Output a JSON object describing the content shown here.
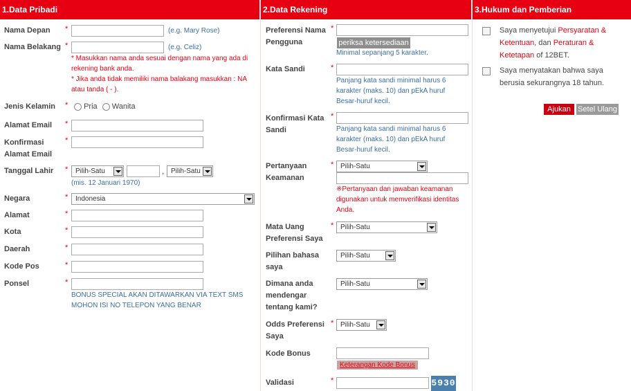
{
  "sections": {
    "personal": "1.Data Pribadi",
    "account": "2.Data Rekening",
    "terms": "3.Hukum dan Pemberian"
  },
  "personal": {
    "first_name": {
      "label": "Nama Depan",
      "value": "",
      "example": "(e.g. Mary Rose)"
    },
    "last_name": {
      "label": "Nama Belakang",
      "value": "",
      "example": "(e.g. Celiz)"
    },
    "last_name_note1": "* Masukkan nama anda sesuai dengan nama yang ada di rekening bank anda.",
    "last_name_note2": "* Jika anda tidak memiliki nama balakang masukkan : NA atau tanda ( - ).",
    "gender": {
      "label": "Jenis Kelamin",
      "male": "Pria",
      "female": "Wanita"
    },
    "email": {
      "label": "Alamat Email",
      "value": ""
    },
    "email_confirm": {
      "label": "Konfirmasi Alamat Email",
      "value": ""
    },
    "birthdate": {
      "label": "Tanggal Lahir",
      "day": "Pilih-Satu",
      "year": "",
      "month": "Pilih-Satu",
      "hint": "(mis. 12 Januari 1970)"
    },
    "country": {
      "label": "Negara",
      "value": "Indonesia"
    },
    "address": {
      "label": "Alamat",
      "value": ""
    },
    "city": {
      "label": "Kota",
      "value": ""
    },
    "region": {
      "label": "Daerah",
      "value": ""
    },
    "postcode": {
      "label": "Kode Pos",
      "value": ""
    },
    "phone": {
      "label": "Ponsel",
      "value": "",
      "hint": "BONUS SPECIAL AKAN DITAWARKAN VIA TEXT SMS MOHON ISI NO TELEPON YANG BENAR"
    }
  },
  "account": {
    "username": {
      "label": "Preferensi Nama Pengguna",
      "value": "",
      "check_button": "periksa ketersediaan",
      "hint": "Minimal sepanjang 5 karakter."
    },
    "password": {
      "label": "Kata Sandi",
      "value": "",
      "hint": "Panjang kata sandi minimal harus 6 karakter (maks. 10) dan pEkA huruf Besar-huruf kecil."
    },
    "password_confirm": {
      "label": "Konfirmasi Kata Sandi",
      "value": "",
      "hint": "Panjang kata sandi minimal harus 6 karakter (maks. 10) dan pEkA huruf Besar-huruf kecil."
    },
    "security_question": {
      "label": "Pertanyaan Keamanan",
      "value": "Pilih-Satu",
      "answer": "",
      "note": "※Pertanyaan dan jawaban keamanan digunakan untuk memverifikasi identitas Anda."
    },
    "currency": {
      "label": "Mata Uang Preferensi Saya",
      "value": "Pilih-Satu"
    },
    "language": {
      "label": "Pilihan bahasa saya",
      "value": "Pilih-Satu"
    },
    "referral": {
      "label": "Dimana anda mendengar tentang kami?",
      "value": "Pilih-Satu"
    },
    "odds": {
      "label": "Odds Preferensi Saya",
      "value": "Pilih-Satu"
    },
    "bonus_code": {
      "label": "Kode Bonus",
      "value": "",
      "info_button": "Keterangan Kode Bonus"
    },
    "validation": {
      "label": "Validasi",
      "value": "",
      "captcha": "5930"
    }
  },
  "terms": {
    "agree_pre": "Saya menyetujui ",
    "agree_link1": "Persyaratan & Ketentuan",
    "agree_mid": ", dan ",
    "agree_link2": "Peraturan & Ketetapan",
    "agree_post": " of 12BET.",
    "age_text": "Saya menyatakan bahwa saya berusia sekurangnya 18 tahun.",
    "submit": "Ajukan",
    "reset": "Setel Ulang"
  },
  "required_mark": "*",
  "colors": {
    "header": "#e60012",
    "accent": "#e60012",
    "hint": "#3a6ea5"
  }
}
